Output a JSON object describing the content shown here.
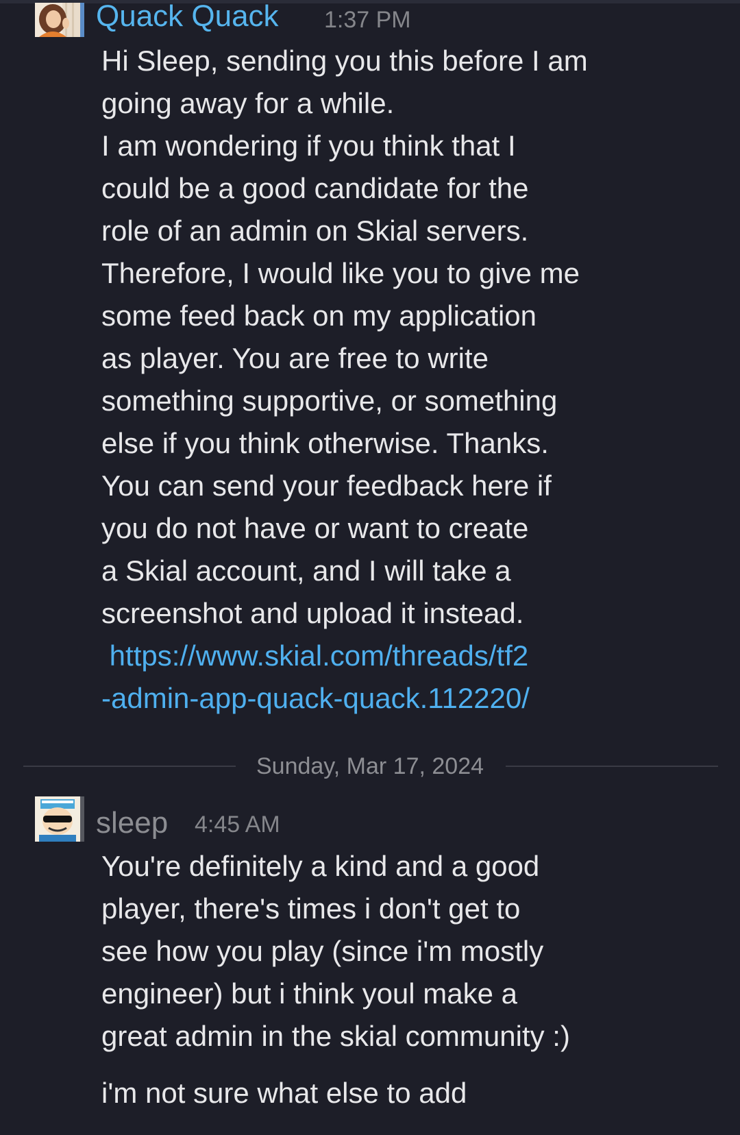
{
  "messages": [
    {
      "author": "Quack Quack",
      "time": "1:37 PM",
      "avatar": "woman-photo-avatar",
      "author_color": "#56b5ee",
      "lines": [
        "Hi Sleep, sending you this before I am",
        "going away for a while.",
        "I am wondering if you think that I",
        "could be a good candidate for the",
        "role of an admin on Skial servers.",
        "Therefore, I would like you to give me",
        "some feed back on my application",
        "as player. You are free to write",
        "something supportive, or something",
        "else if you think otherwise. Thanks.",
        "You can send your feedback here if",
        "you do not have or want to create",
        "a Skial account, and I will take a",
        "screenshot and upload it instead."
      ],
      "link_lines": [
        " https://www.skial.com/threads/tf2",
        "-admin-app-quack-quack.112220/"
      ]
    },
    {
      "author": "sleep",
      "time": "4:45 AM",
      "avatar": "cartoon-sunglasses-avatar",
      "author_color": "#8c8d92",
      "lines": [
        "You're definitely a kind and a good",
        "player, there's times i don't get to",
        "see how you play (since i'm mostly",
        "engineer) but i think youl make a",
        "great admin in the skial community :)"
      ],
      "followup": "i'm not sure what else to add"
    }
  ],
  "date_divider": "Sunday, Mar 17, 2024",
  "colors": {
    "background": "#1d1e28",
    "text": "#e8e8ea",
    "link": "#4fb0ef",
    "divider": "#3a3b45"
  }
}
